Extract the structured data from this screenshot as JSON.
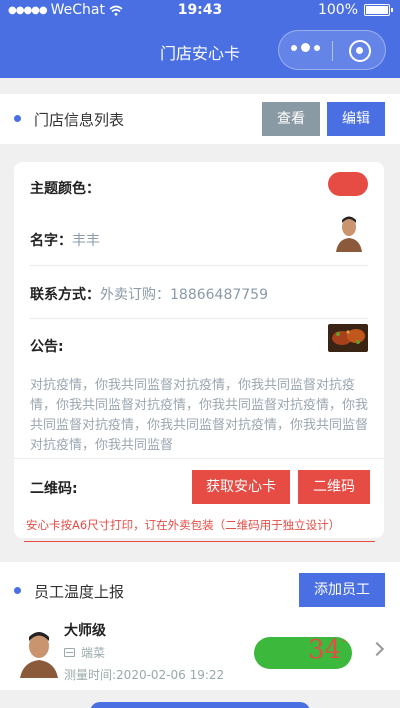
{
  "status_bar": {
    "carrier": "WeChat",
    "time": "19:43",
    "battery": "100%"
  },
  "nav": {
    "title": "门店安心卡"
  },
  "store_section": {
    "title": "门店信息列表",
    "view_label": "查看",
    "edit_label": "编辑"
  },
  "store_card": {
    "theme_label": "主题颜色：",
    "theme_color": "#e74c44",
    "name_label": "名字：",
    "name_value": "丰丰",
    "contact_label": "联系方式：",
    "contact_value": "外卖订购：18866487759",
    "notice_label": "公告:",
    "notice_text": "对抗疫情，你我共同监督对抗疫情，你我共同监督对抗疫情，你我共同监督对抗疫情，你我共同监督对抗疫情，你我共同监督对抗疫情，你我共同监督对抗疫情，你我共同监督对抗疫情，你我共同监督",
    "qr_label": "二维码:",
    "get_card_label": "获取安心卡",
    "qr_button_label": "二维码"
  },
  "tip": "安心卡按A6尺寸打印，订在外卖包装（二维码用于独立设计）",
  "staff_section": {
    "title": "员工温度上报",
    "add_label": "添加员工",
    "employee": {
      "name": "大师级",
      "role": "端菜",
      "time": "测量时间:2020-02-06 19:22",
      "temperature": "34",
      "unit": "°"
    }
  },
  "colors": {
    "primary": "#4a6fe3",
    "danger": "#e74c44",
    "success": "#3cb83c"
  }
}
